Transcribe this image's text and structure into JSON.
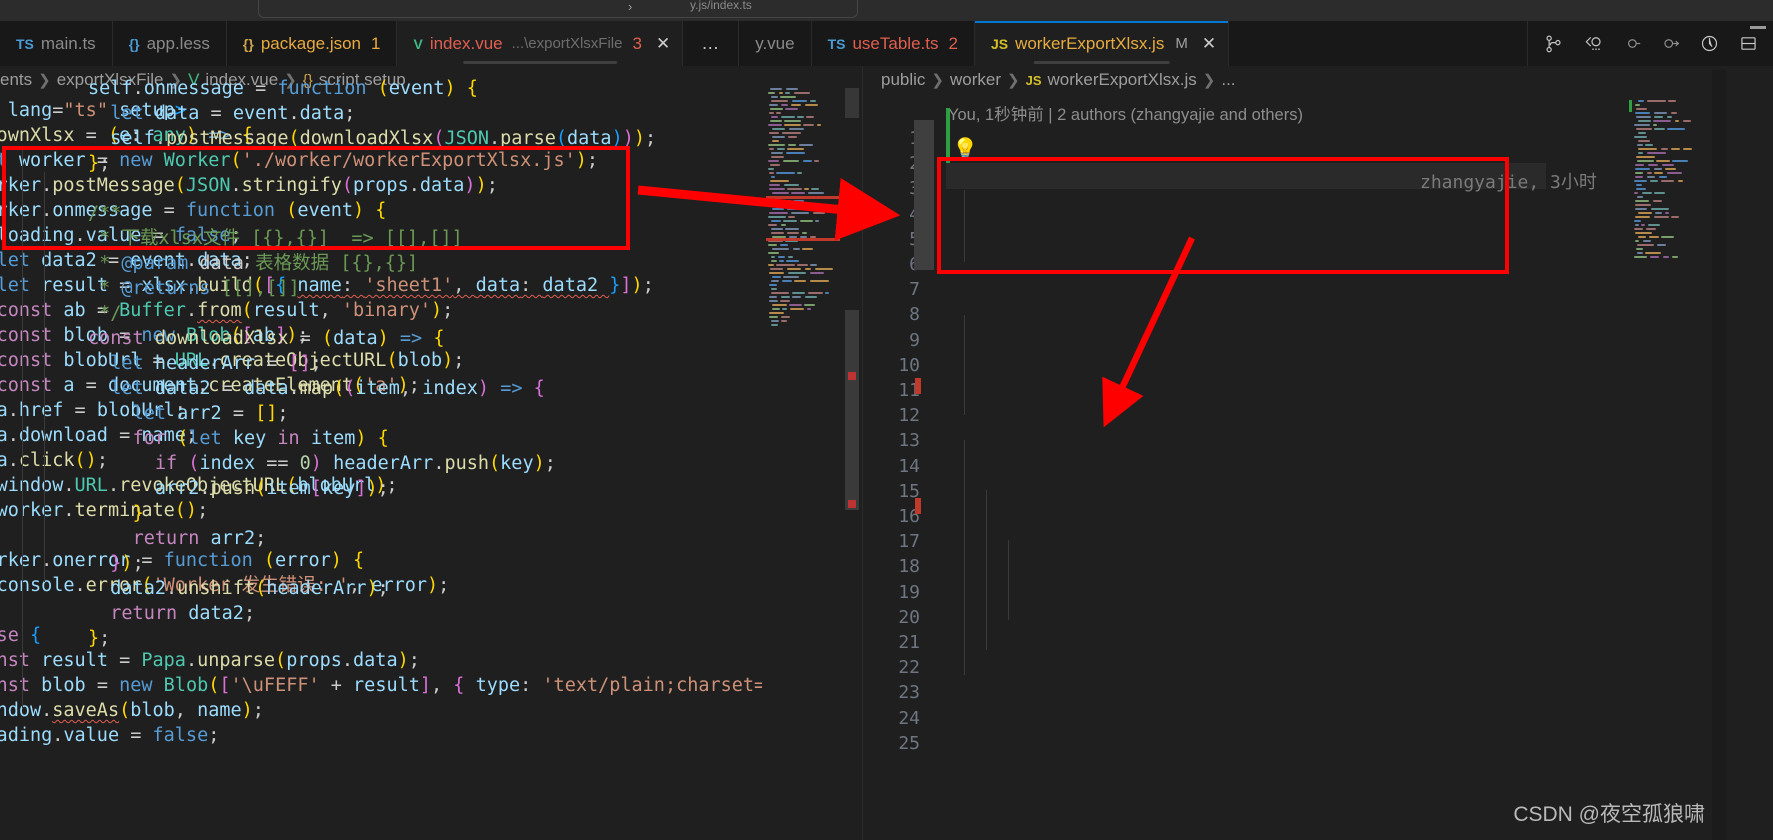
{
  "window": {
    "quick_input_text": "y.js/index.ts",
    "watermark": "CSDN @夜空孤狼啸"
  },
  "tabs": [
    {
      "icon": "ts-file-icon",
      "icon_label": "TS",
      "name": "main.ts",
      "badge": "",
      "desc": "",
      "modified": "",
      "active": false
    },
    {
      "icon": "less-file-icon",
      "icon_label": "{}",
      "name": "app.less",
      "badge": "",
      "desc": "",
      "modified": "",
      "active": false
    },
    {
      "icon": "json-file-icon",
      "icon_label": "{}",
      "name": "package.json",
      "badge": "1",
      "desc": "",
      "modified": "",
      "active": false
    },
    {
      "icon": "vue-file-icon",
      "icon_label": "V",
      "name": "index.vue",
      "badge": "3",
      "desc": "...\\exportXlsxFile",
      "modified": "",
      "active": true
    },
    {
      "icon": "more-icon",
      "icon_label": "…",
      "name": "",
      "badge": "",
      "desc": "",
      "modified": "",
      "active": false
    },
    {
      "icon": "vue-file-icon",
      "icon_label": "",
      "name": "y.vue",
      "badge": "",
      "desc": "",
      "modified": "",
      "active": false
    },
    {
      "icon": "ts-file-icon",
      "icon_label": "TS",
      "name": "useTable.ts",
      "badge": "2",
      "desc": "",
      "modified": "",
      "active": false
    },
    {
      "icon": "js-file-icon",
      "icon_label": "JS",
      "name": "workerExportXlsx.js",
      "badge": "",
      "desc": "",
      "modified": "M",
      "active": true
    }
  ],
  "toolbar_icons": [
    {
      "name": "source-control-icon",
      "glyph": "branch"
    },
    {
      "name": "compare-changes-icon",
      "glyph": "compare"
    },
    {
      "name": "previous-change-icon",
      "glyph": "prev"
    },
    {
      "name": "next-change-icon",
      "glyph": "next"
    },
    {
      "name": "timeline-icon",
      "glyph": "clock"
    },
    {
      "name": "split-editor-icon",
      "glyph": "split"
    }
  ],
  "breadcrumbs": {
    "left": [
      "ents",
      "exportXlsxFile",
      "index.vue",
      "script setup"
    ],
    "right": [
      "public",
      "worker",
      "workerExportXlsx.js",
      "..."
    ]
  },
  "git_blame": {
    "header": "You, 1秒钟前 | 2 authors (zhangyajie and others)",
    "inline": "zhangyajie, 3小时"
  },
  "left_editor": {
    "file": "index.vue",
    "lines": [
      "ript lang=\"ts\" setup>",
      "st downXlsx = (e: any) => {",
      "  let worker = new Worker('./worker/workerExportXlsx.js');",
      "  worker.postMessage(JSON.stringify(props.data));",
      "  worker.onmessage = function (event) {",
      "    loading.value = false;",
      "    let data2 = event.data;",
      "    let result = xlsx.build([{ name: 'sheet1', data: data2 }]);",
      "    const ab = Buffer.from(result, 'binary');",
      "    const blob = new Blob([ab]);",
      "    const blobUrl = URL.createObjectURL(blob);",
      "    const a = document.createElement('a');",
      "    a.href = blobUrl;",
      "    a.download = name;",
      "    a.click();",
      "    window.URL.revokeObjectURL(blobUrl);",
      "    worker.terminate();",
      "  };",
      "  worker.onerror = function (error) {",
      "    console.error('Worker 发生错误: ', error);",
      "  };",
      "} else {",
      "  const result = Papa.unparse(props.data);",
      "  const blob = new Blob(['\\uFEFF' + result], { type: 'text/plain;charset=u",
      "  window.saveAs(blob, name);",
      "  loading.value = false;"
    ]
  },
  "right_editor": {
    "file": "workerExportXlsx.js",
    "line_numbers": [
      1,
      2,
      3,
      4,
      5,
      6,
      7,
      8,
      9,
      10,
      11,
      12,
      13,
      14,
      15,
      16,
      17,
      18,
      19,
      20,
      21,
      22,
      23,
      24,
      25
    ],
    "lines": [
      "",
      "",
      "self.onmessage = function (event) {",
      "  let data = event.data;",
      "  self.postMessage(downloadXlsx(JSON.parse(data)));",
      "};",
      "",
      "/**",
      " * 下载xlsx文件 [{},{}]  => [[],[]]",
      " * @param data 表格数据 [{},{}]",
      " * @returns [[],[]]",
      " */",
      "const downloadXlsx = (data) => {",
      "  let headerArr = [];",
      "  let data2 = data.map((item, index) => {",
      "    let arr2 = [];",
      "    for (let key in item) {",
      "      if (index == 0) headerArr.push(key);",
      "      arr2.push(item[key]);",
      "    }",
      "    return arr2;",
      "  });",
      "  data2.unshift(headerArr);",
      "  return data2;",
      "};"
    ]
  },
  "annotations": {
    "box_left_label": "worker creation block highlight",
    "box_right_label": "self.onmessage handler highlight",
    "arrow_count": 2,
    "color": "#ff0000"
  }
}
